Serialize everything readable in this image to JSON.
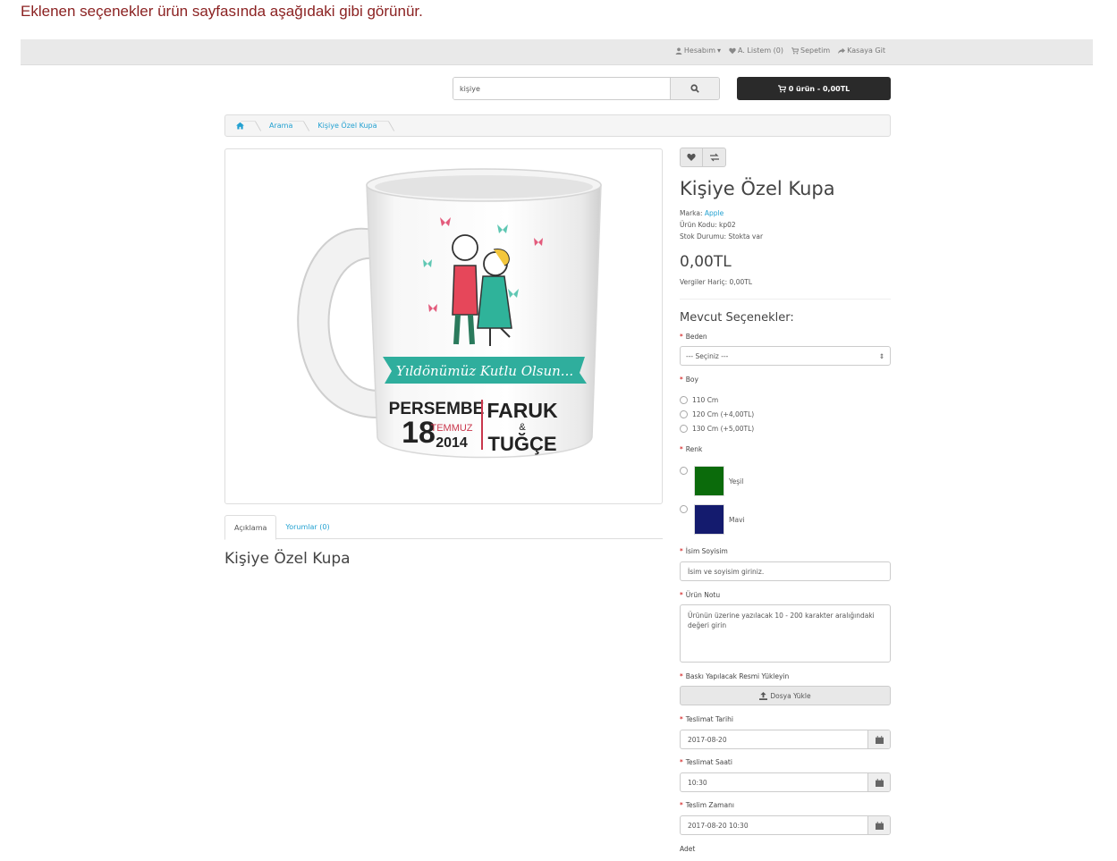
{
  "intro": "Eklenen seçenekler ürün sayfasında aşağıdaki gibi görünür.",
  "topbar": {
    "account": "Hesabım",
    "wishlist": "A. Listem (0)",
    "cart": "Sepetim",
    "checkout": "Kasaya Git"
  },
  "search": {
    "value": "kişiye"
  },
  "cart_button": "0 ürün - 0,00TL",
  "breadcrumb": [
    "Arama",
    "Kişiye Özel Kupa"
  ],
  "product": {
    "title": "Kişiye Özel Kupa",
    "brand_label": "Marka:",
    "brand": "Apple",
    "code": "Ürün Kodu: kp02",
    "stock": "Stok Durumu: Stokta var",
    "price": "0,00TL",
    "ex_tax": "Vergiler Hariç: 0,00TL"
  },
  "mug": {
    "banner": "Yıldönümüz Kutlu Olsun...",
    "day_name": "PERSEMBE",
    "day": "18",
    "month": "TEMMUZ",
    "year": "2014",
    "name1": "FARUK",
    "amp": "&",
    "name2": "TUĞÇE"
  },
  "tabs": {
    "description": "Açıklama",
    "reviews": "Yorumlar (0)"
  },
  "description_title": "Kişiye Özel Kupa",
  "options": {
    "title": "Mevcut Seçenekler:",
    "size_label": "Beden",
    "size_select": "--- Seçiniz ---",
    "height_label": "Boy",
    "heights": [
      "110 Cm",
      "120 Cm (+4,00TL)",
      "130 Cm (+5,00TL)"
    ],
    "color_label": "Renk",
    "colors": [
      {
        "name": "Yeşil",
        "hex": "#0b6b0b"
      },
      {
        "name": "Mavi",
        "hex": "#141b6e"
      }
    ],
    "name_label": "İsim Soyisim",
    "name_placeholder": "İsim ve soyisim giriniz.",
    "note_label": "Ürün Notu",
    "note_placeholder": "Ürünün üzerine yazılacak 10 - 200 karakter aralığındaki değeri girin",
    "upload_label": "Baskı Yapılacak Resmi Yükleyin",
    "upload_button": "Dosya Yükle",
    "date_label": "Teslimat Tarihi",
    "date_value": "2017-08-20",
    "time_label": "Teslimat Saati",
    "time_value": "10:30",
    "datetime_label": "Teslim Zamanı",
    "datetime_value": "2017-08-20 10:30",
    "qty_label": "Adet"
  }
}
